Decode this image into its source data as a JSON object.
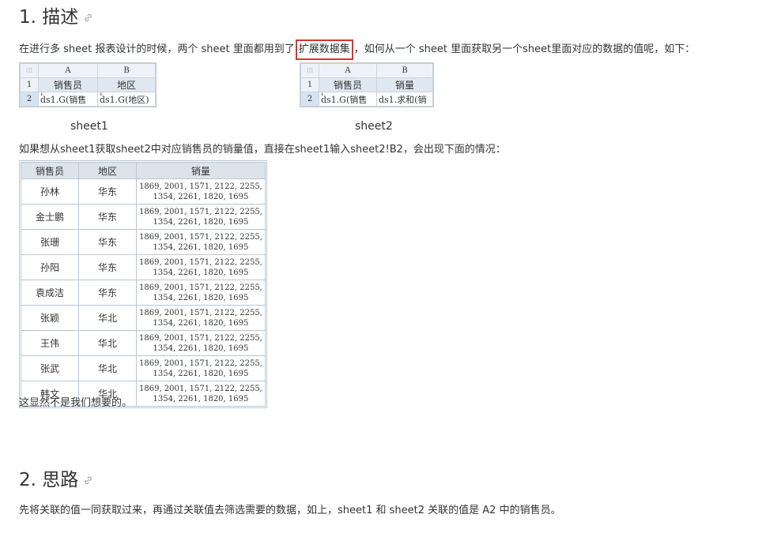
{
  "section1": {
    "heading": "1. 描述",
    "intro_before": "在进行多 sheet 报表设计的时候，两个 sheet 里面都用到了",
    "intro_highlight": "扩展数据集",
    "intro_after": "，如何从一个 sheet 里面获取另一个sheet里面对应的数据的值呢，如下：",
    "sheet1": {
      "caption": "sheet1",
      "corner_icon": "grid-icon",
      "columns": [
        "A",
        "B"
      ],
      "rows": [
        {
          "num": "1",
          "cells": [
            "销售员",
            "地区"
          ]
        },
        {
          "num": "2",
          "cells": [
            "ds1.G(销售",
            "ds1.G(地区)"
          ]
        }
      ]
    },
    "sheet2": {
      "caption": "sheet2",
      "corner_icon": "grid-icon",
      "columns": [
        "A",
        "B"
      ],
      "rows": [
        {
          "num": "1",
          "cells": [
            "销售员",
            "销量"
          ]
        },
        {
          "num": "2",
          "cells": [
            "ds1.G(销售",
            "ds1.求和(销"
          ]
        }
      ]
    },
    "question": "如果想从sheet1获取sheet2中对应销售员的销量值，直接在sheet1输入sheet2!B2，会出现下面的情况：",
    "result_table": {
      "headers": [
        "销售员",
        "地区",
        "销量"
      ],
      "rows": [
        {
          "name": "孙林",
          "region": "华东",
          "sales_1": "1869, 2001, 1571, 2122, 2255,",
          "sales_2": "1354, 2261, 1820, 1695"
        },
        {
          "name": "金士鹏",
          "region": "华东",
          "sales_1": "1869, 2001, 1571, 2122, 2255,",
          "sales_2": "1354, 2261, 1820, 1695"
        },
        {
          "name": "张珊",
          "region": "华东",
          "sales_1": "1869, 2001, 1571, 2122, 2255,",
          "sales_2": "1354, 2261, 1820, 1695"
        },
        {
          "name": "孙阳",
          "region": "华东",
          "sales_1": "1869, 2001, 1571, 2122, 2255,",
          "sales_2": "1354, 2261, 1820, 1695"
        },
        {
          "name": "袁成洁",
          "region": "华东",
          "sales_1": "1869, 2001, 1571, 2122, 2255,",
          "sales_2": "1354, 2261, 1820, 1695"
        },
        {
          "name": "张颖",
          "region": "华北",
          "sales_1": "1869, 2001, 1571, 2122, 2255,",
          "sales_2": "1354, 2261, 1820, 1695"
        },
        {
          "name": "王伟",
          "region": "华北",
          "sales_1": "1869, 2001, 1571, 2122, 2255,",
          "sales_2": "1354, 2261, 1820, 1695"
        },
        {
          "name": "张武",
          "region": "华北",
          "sales_1": "1869, 2001, 1571, 2122, 2255,",
          "sales_2": "1354, 2261, 1820, 1695"
        },
        {
          "name": "韩文",
          "region": "华北",
          "sales_1": "1869, 2001, 1571, 2122, 2255,",
          "sales_2": "1354, 2261, 1820, 1695"
        }
      ]
    },
    "conclusion": "这显然不是我们想要的。"
  },
  "section2": {
    "heading": "2. 思路",
    "text": "先将关联的值一同获取过来，再通过关联值去筛选需要的数据，如上，sheet1 和 sheet2 关联的值是 A2 中的销售员。"
  },
  "colors": {
    "highlight_border": "#e03030",
    "header_bg": "#dde3ea",
    "text": "#333333"
  }
}
